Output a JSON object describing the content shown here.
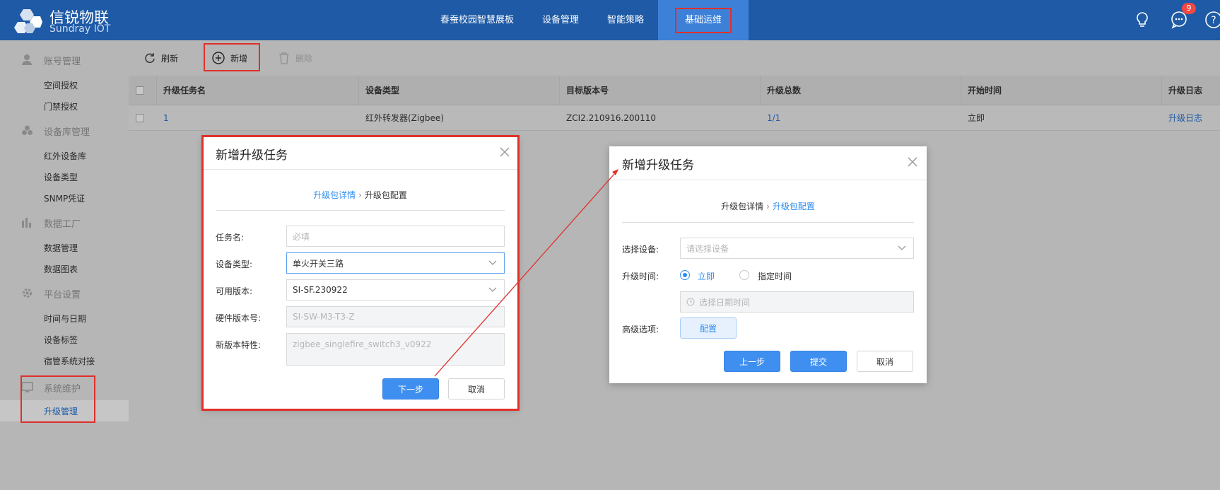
{
  "header": {
    "logo_name": "信锐物联",
    "logo_sub": "Sundray IOT",
    "nav": [
      "春蚕校园智慧展板",
      "设备管理",
      "智能策略",
      "基础运维"
    ],
    "notification_count": "9",
    "colors": {
      "header_bg": "#1e5aa6",
      "active_tab": "#3d80d8",
      "highlight": "#e0302b"
    }
  },
  "sidebar": {
    "groups": [
      {
        "label": "账号管理",
        "icon": "user-icon",
        "items": [
          "空间授权",
          "门禁授权"
        ]
      },
      {
        "label": "设备库管理",
        "icon": "cube-icon",
        "items": [
          "红外设备库",
          "设备类型",
          "SNMP凭证"
        ]
      },
      {
        "label": "数据工厂",
        "icon": "chart-icon",
        "items": [
          "数据管理",
          "数据图表"
        ]
      },
      {
        "label": "平台设置",
        "icon": "gear-icon",
        "items": [
          "时间与日期",
          "设备标签",
          "宿管系统对接"
        ]
      },
      {
        "label": "系统维护",
        "icon": "monitor-icon",
        "items": [
          "升级管理"
        ]
      }
    ]
  },
  "toolbar": {
    "refresh": "刷新",
    "add": "新增",
    "delete": "删除"
  },
  "table": {
    "headers": [
      "升级任务名",
      "设备类型",
      "目标版本号",
      "升级总数",
      "开始时间",
      "升级日志"
    ],
    "rows": [
      [
        "1",
        "红外转发器(Zigbee)",
        "ZCI2.210916.200110",
        "1/1",
        "立即",
        "升级日志"
      ]
    ]
  },
  "dialog1": {
    "title": "新增升级任务",
    "step1": "升级包详情",
    "step2": "升级包配置",
    "task_name_label": "任务名:",
    "task_name_placeholder": "必填",
    "device_type_label": "设备类型:",
    "device_type_value": "单火开关三路",
    "version_label": "可用版本:",
    "version_value": "SI-SF.230922",
    "hw_label": "硬件版本号:",
    "hw_value": "SI-SW-M3-T3-Z",
    "feature_label": "新版本特性:",
    "feature_value": "zigbee_singlefire_switch3_v0922",
    "next_button": "下一步",
    "cancel_button": "取消"
  },
  "dialog2": {
    "title": "新增升级任务",
    "step1": "升级包详情",
    "step2": "升级包配置",
    "select_device_label": "选择设备:",
    "select_device_placeholder": "请选择设备",
    "upgrade_time_label": "升级时间:",
    "radio_now": "立即",
    "radio_scheduled": "指定时间",
    "datetime_placeholder": "选择日期时间",
    "advanced_label": "高级选项:",
    "config_button": "配置",
    "prev_button": "上一步",
    "submit_button": "提交",
    "cancel_button": "取消"
  }
}
